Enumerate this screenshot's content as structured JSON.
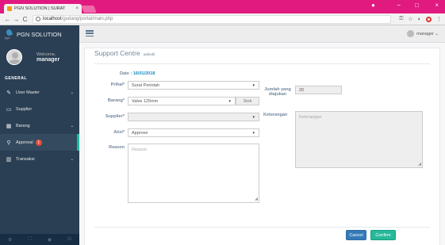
{
  "browser": {
    "tab_title": "PGN SOLUTION | SURAT",
    "tab_close": "×",
    "url_host": "localhost",
    "url_path": "/gudang/portal/main.php",
    "back": "←",
    "forward": "→",
    "reload": "C",
    "key_icon": "⚿",
    "star_icon": "☆"
  },
  "sidebar": {
    "brand_sub": "pgn",
    "brand": "PGN SOLUTION",
    "welcome": "Welcome,",
    "username": "manager",
    "section": "GENERAL",
    "items": [
      {
        "label": "User Master",
        "icon": "✎",
        "caret": "⌄"
      },
      {
        "label": "Supplier",
        "icon": "▭"
      },
      {
        "label": "Barang",
        "icon": "▦",
        "caret": "⌄"
      },
      {
        "label": "Approval",
        "icon": "⚲",
        "badge": "1"
      },
      {
        "label": "Transaksi",
        "icon": "▥",
        "caret": "⌄"
      }
    ],
    "footer_icons": [
      "⚙",
      "⛶",
      "◉",
      "⏻"
    ]
  },
  "topnav": {
    "user": "manager ⌄"
  },
  "panel": {
    "title": "Support Centre",
    "subtitle": "addedit"
  },
  "form": {
    "date_label": "Date : ",
    "date_value": "16/01/2018",
    "perihal_label": "Prihal*",
    "perihal_value": "Surat Perintah",
    "barang_label": "Barang*",
    "barang_value": "Valve 125mm",
    "stok_label": "Stok",
    "supplier_label": "Supplier*",
    "supplier_value": "",
    "aksi_label": "Aksi*",
    "aksi_value": "Approve",
    "reason_label": "Reason",
    "reason_placeholder": "Reason",
    "jumlah_label": "Jumlah yang diajukan",
    "jumlah_value": "20",
    "keterangan_label": "Keterangan",
    "keterangan_placeholder": "Keterangan",
    "select_caret": "▾"
  },
  "actions": {
    "cancel": "Cancel",
    "confirm": "Confirm"
  }
}
